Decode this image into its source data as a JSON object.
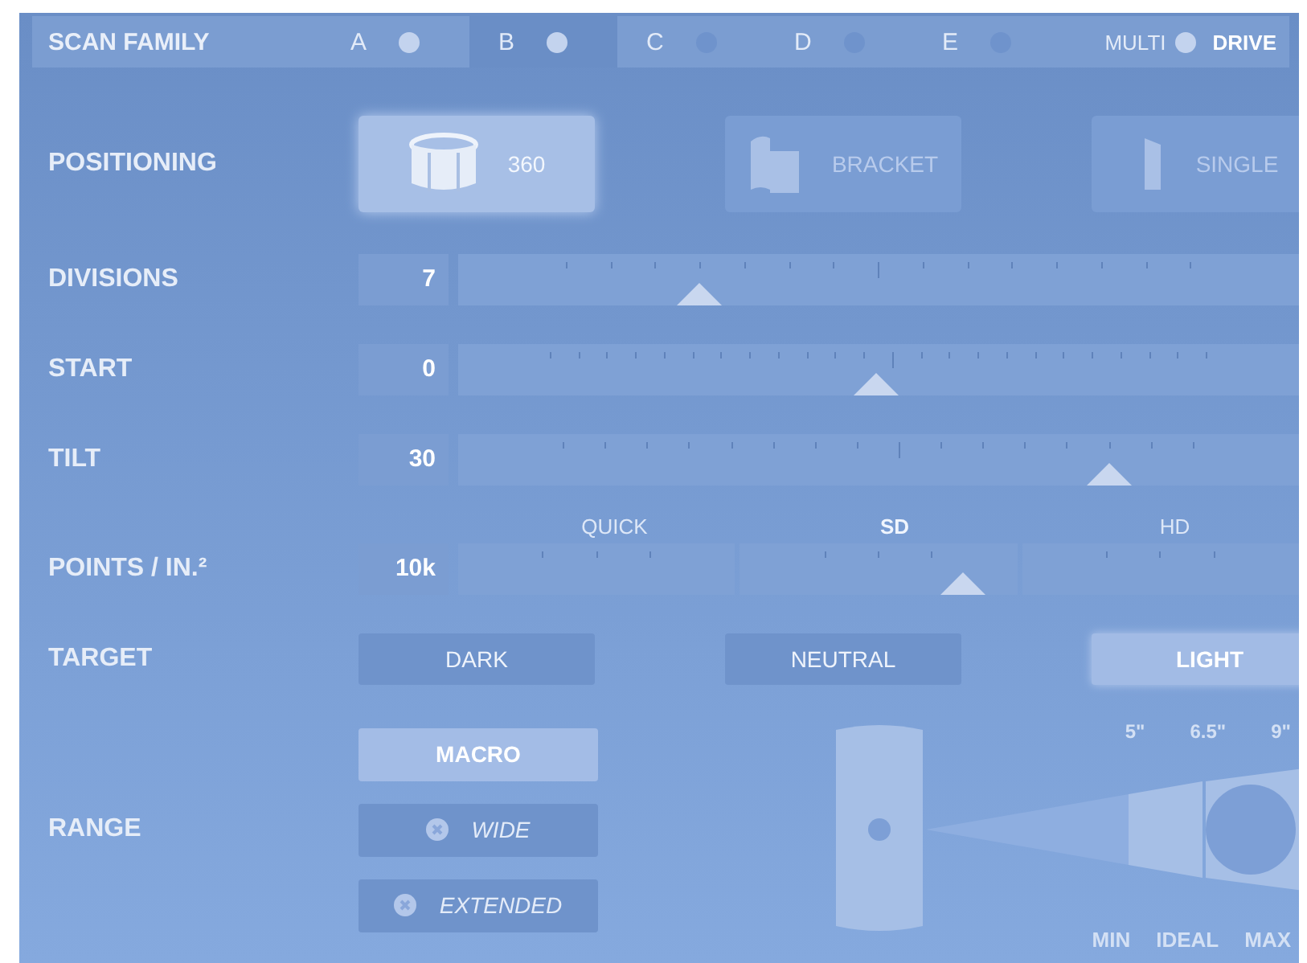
{
  "header": {
    "title": "SCAN FAMILY"
  },
  "tabs": [
    {
      "label": "A",
      "selected": false,
      "on": false
    },
    {
      "label": "B",
      "selected": true,
      "on": false
    },
    {
      "label": "C",
      "selected": false,
      "on": true
    },
    {
      "label": "D",
      "selected": false,
      "on": true
    },
    {
      "label": "E",
      "selected": false,
      "on": true
    }
  ],
  "multi_drive": {
    "label": "MULTI",
    "value": "DRIVE",
    "on": false
  },
  "positioning": {
    "label": "POSITIONING",
    "options": [
      {
        "label": "360",
        "selected": true,
        "kind": "ring"
      },
      {
        "label": "BRACKET",
        "selected": false,
        "kind": "bracket"
      },
      {
        "label": "SINGLE",
        "selected": false,
        "kind": "single"
      }
    ]
  },
  "sliders": [
    {
      "label": "DIVISIONS",
      "value": "7",
      "level": 0.287
    },
    {
      "label": "START",
      "value": "0",
      "level": 0.497
    },
    {
      "label": "TILT",
      "value": "30",
      "level": 0.774
    }
  ],
  "points": {
    "label": "POINTS / IN.²",
    "value": "10k",
    "level": 0.6,
    "presets": [
      {
        "label": "QUICK",
        "selected": false
      },
      {
        "label": "SD",
        "selected": true
      },
      {
        "label": "HD",
        "selected": false
      }
    ]
  },
  "target": {
    "label": "TARGET",
    "options": [
      {
        "label": "DARK",
        "selected": false
      },
      {
        "label": "NEUTRAL",
        "selected": false
      },
      {
        "label": "LIGHT",
        "selected": true
      }
    ]
  },
  "range": {
    "label": "RANGE",
    "options": [
      {
        "label": "MACRO",
        "selected": true,
        "disabled": false
      },
      {
        "label": "WIDE",
        "selected": false,
        "disabled": true
      },
      {
        "label": "EXTENDED",
        "selected": false,
        "disabled": true
      }
    ],
    "distances": [
      "5\"",
      "6.5\"",
      "9\""
    ],
    "marks": [
      "MIN",
      "IDEAL",
      "MAX"
    ]
  }
}
